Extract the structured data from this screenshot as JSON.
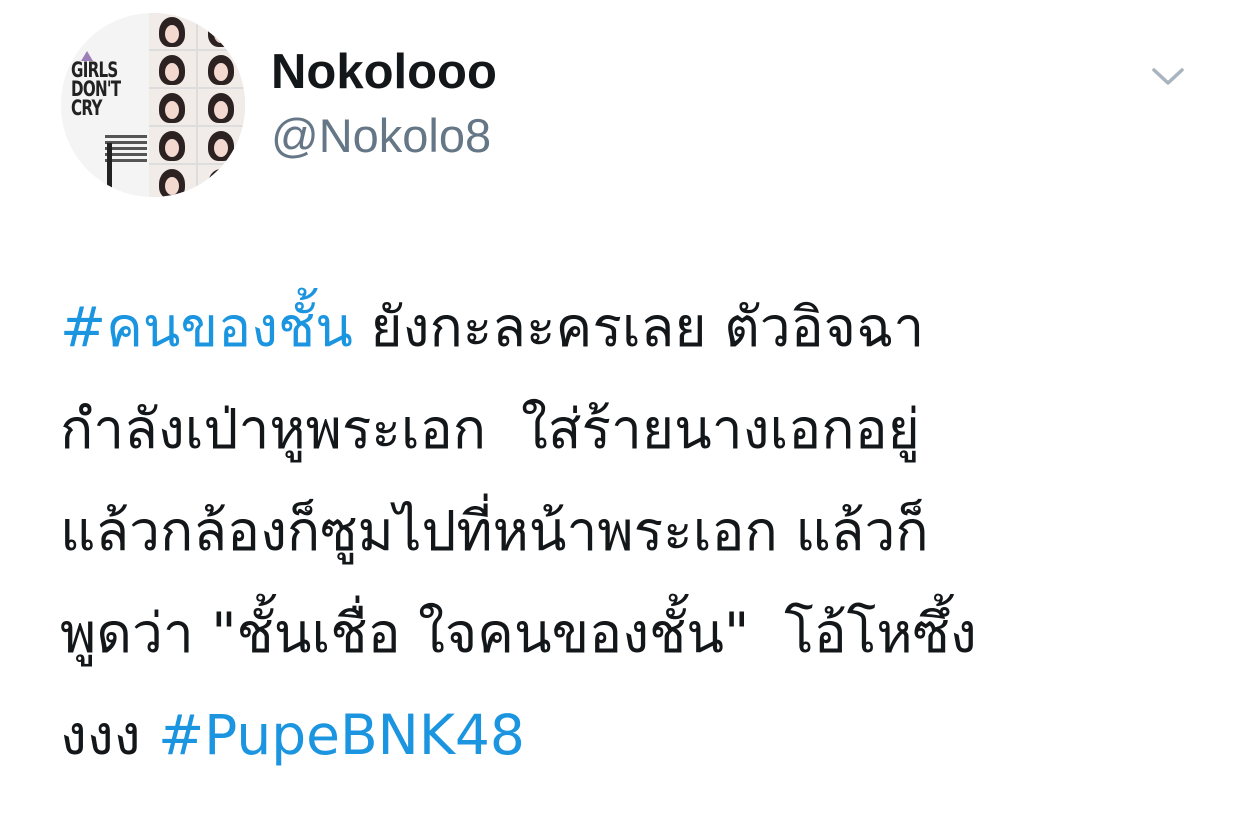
{
  "user": {
    "display_name": "Nokolooo",
    "handle": "@Nokolo8",
    "avatar_text": "GIRLS\nDON'T\nCRY"
  },
  "tweet": {
    "lines": [
      [
        {
          "text": "#คนของชั้น",
          "kind": "hashtag"
        },
        {
          "text": " ยังกะละครเลย ตัวอิจฉา",
          "kind": "text"
        }
      ],
      [
        {
          "text": "กำลังเป่าหูพระเอก  ใส่ร้ายนางเอกอยู่",
          "kind": "text"
        }
      ],
      [
        {
          "text": "แล้วกล้องก็ซูมไปที่หน้าพระเอก แล้วก็",
          "kind": "text"
        }
      ],
      [
        {
          "text": "พูดว่า \"ชั้นเชื่อ ใจคนของชั้น\"  โอ้โหซึ้ง",
          "kind": "text"
        }
      ],
      [
        {
          "text": "งงง ",
          "kind": "text"
        },
        {
          "text": "#PupeBNK48",
          "kind": "hashtag"
        }
      ]
    ]
  },
  "icons": {
    "menu": "chevron-down-icon"
  },
  "colors": {
    "hashtag": "#1b95e0",
    "text": "#14171a",
    "handle": "#657786",
    "chevron": "#a8b4be"
  }
}
